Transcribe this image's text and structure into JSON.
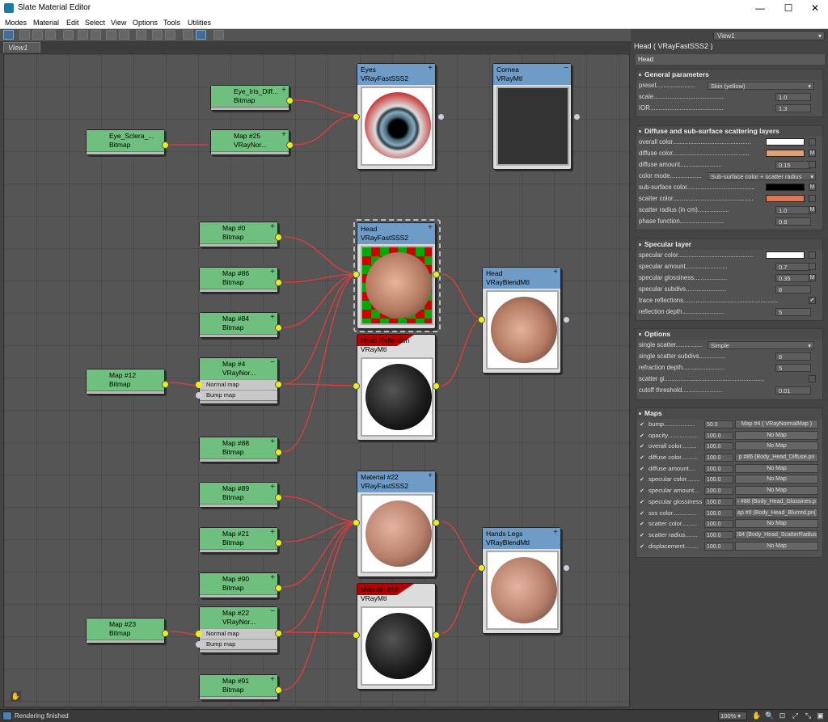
{
  "window": {
    "title": "Slate Material Editor",
    "minimize": "—",
    "maximize": "☐",
    "close": "✕"
  },
  "menu": [
    "Modes",
    "Material",
    "Edit",
    "Select",
    "View",
    "Options",
    "Tools",
    "Utilities"
  ],
  "view_dropdown": "View1",
  "tab": "View1",
  "nodes": {
    "eye_iris": {
      "l1": "Eye_Iris_Diff...",
      "l2": "Bitmap"
    },
    "eye_sclera": {
      "l1": "Eye_Sclera_...",
      "l2": "Bitmap"
    },
    "map25": {
      "l1": "Map #25",
      "l2": "VRayNor..."
    },
    "eyes": {
      "l1": "Eyes",
      "l2": "VRayFastSSS2"
    },
    "cornea": {
      "l1": "Cornea",
      "l2": "VRayMtl"
    },
    "map0": {
      "l1": "Map #0",
      "l2": "Bitmap"
    },
    "map86": {
      "l1": "Map #86",
      "l2": "Bitmap"
    },
    "map84": {
      "l1": "Map #84",
      "l2": "Bitmap"
    },
    "map4": {
      "l1": "Map #4",
      "l2": "VRayNor...",
      "s1": "Normal map",
      "s2": "Bump map"
    },
    "map12": {
      "l1": "Map #12",
      "l2": "Bitmap"
    },
    "map88": {
      "l1": "Map #88",
      "l2": "Bitmap"
    },
    "head_sss": {
      "l1": "Head",
      "l2": "VRayFastSSS2"
    },
    "head_refl": {
      "l1": "Head Reflection",
      "l2": "VRayMtl"
    },
    "head_blend": {
      "l1": "Head",
      "l2": "VRayBlendMtl"
    },
    "map89": {
      "l1": "Map #89",
      "l2": "Bitmap"
    },
    "map21": {
      "l1": "Map #21",
      "l2": "Bitmap"
    },
    "map90": {
      "l1": "Map #90",
      "l2": "Bitmap"
    },
    "map22": {
      "l1": "Map #22",
      "l2": "VRayNor...",
      "s1": "Normal map",
      "s2": "Bump map"
    },
    "map23": {
      "l1": "Map #23",
      "l2": "Bitmap"
    },
    "map91": {
      "l1": "Map #91",
      "l2": "Bitmap"
    },
    "mat22": {
      "l1": "Material #22",
      "l2": "VRayFastSSS2"
    },
    "mat18": {
      "l1": "Material #18",
      "l2": "VRayMtl"
    },
    "handslegs": {
      "l1": "Hands Legs",
      "l2": "VRayBlendMtl"
    }
  },
  "panel": {
    "title": "Head  ( VRayFastSSS2 )",
    "name": "Head",
    "general": {
      "header": "General parameters",
      "rows": [
        {
          "label": "preset......................",
          "value": "Skin (yellow)",
          "type": "dropdown"
        },
        {
          "label": "scale........................................",
          "value": "1.0",
          "type": "spin"
        },
        {
          "label": "IOR..........................................",
          "value": "1.3",
          "type": "spin"
        }
      ]
    },
    "diffuse": {
      "header": "Diffuse and sub-surface scattering layers",
      "rows": [
        {
          "label": "overall color.............................................",
          "color": "#ffffff",
          "type": "color"
        },
        {
          "label": "diffuse color............................................",
          "color": "#d9a27a",
          "type": "color",
          "m": "M"
        },
        {
          "label": "diffuse amount........................",
          "value": "0.15",
          "type": "spin"
        },
        {
          "label": "color mode..................",
          "value": "Sub-surface color + scatter radius",
          "type": "dropdown"
        },
        {
          "label": "sub-surface color.......................................",
          "color": "#000000",
          "type": "color",
          "m": "M"
        },
        {
          "label": "scatter color..............................................",
          "color": "#d87a5a",
          "type": "color"
        },
        {
          "label": "scatter radius (in cm)..................",
          "value": "1.0",
          "type": "spin",
          "m": "M"
        },
        {
          "label": "phase function.........................",
          "value": "0.8",
          "type": "spin"
        }
      ]
    },
    "specular": {
      "header": "Specular layer",
      "rows": [
        {
          "label": "specular color...........................................",
          "color": "#ffffff",
          "type": "color"
        },
        {
          "label": "specular amount........................",
          "value": "0.7",
          "type": "spin"
        },
        {
          "label": "specular glossiness...................",
          "value": "0.35",
          "type": "spin",
          "m": "M"
        },
        {
          "label": "specular subdivs.......................",
          "value": "8",
          "type": "spin"
        },
        {
          "label": "trace reflections......................................................",
          "check": "✔",
          "type": "check"
        },
        {
          "label": "reflection depth........................",
          "value": "5",
          "type": "spin"
        }
      ]
    },
    "options": {
      "header": "Options",
      "rows": [
        {
          "label": "single scatter...............",
          "value": "Simple",
          "type": "dropdown"
        },
        {
          "label": "single scatter subdivs...............",
          "value": "8",
          "type": "spin"
        },
        {
          "label": "refraction depth........................",
          "value": "5",
          "type": "spin"
        },
        {
          "label": "scatter gi.........................................................",
          "check": "",
          "type": "check"
        },
        {
          "label": "cutoff threshold.......................",
          "value": "0.01",
          "type": "spin"
        }
      ]
    },
    "maps": {
      "header": "Maps",
      "rows": [
        {
          "label": "bump..................",
          "amount": "50.0",
          "map": "Map #4  ( VRayNormalMap )"
        },
        {
          "label": "opacity..................",
          "amount": "100.0",
          "map": "No Map"
        },
        {
          "label": "overall color.........",
          "amount": "100.0",
          "map": "No Map"
        },
        {
          "label": "diffuse color..........",
          "amount": "100.0",
          "map": "p #86 (Body_Head_Diffuse.pn"
        },
        {
          "label": "diffuse amount....",
          "amount": "100.0",
          "map": "No Map"
        },
        {
          "label": "specular color........",
          "amount": "100.0",
          "map": "No Map"
        },
        {
          "label": "specular amount...",
          "amount": "100.0",
          "map": "No Map"
        },
        {
          "label": "specular glossiness",
          "amount": "100.0",
          "map": "ı #88 (Body_Head_Glossines.p"
        },
        {
          "label": "sss color..............",
          "amount": "100.0",
          "map": "ap #0 (Body_Head_Blurred.pn("
        },
        {
          "label": "scatter color.........",
          "amount": "100.0",
          "map": "No Map"
        },
        {
          "label": "scatter radius.......",
          "amount": "100.0",
          "map": "!84 (Body_Head_ScatterRadius"
        },
        {
          "label": "displacement........",
          "amount": "100.0",
          "map": "No Map"
        }
      ]
    }
  },
  "status": {
    "text": "Rendering finished",
    "zoom": "100%"
  },
  "colors": {
    "node_green": "#6fbf7e",
    "node_blue": "#6f9cc7",
    "wire": "#e83a3a",
    "socket": "#e8f01a"
  }
}
